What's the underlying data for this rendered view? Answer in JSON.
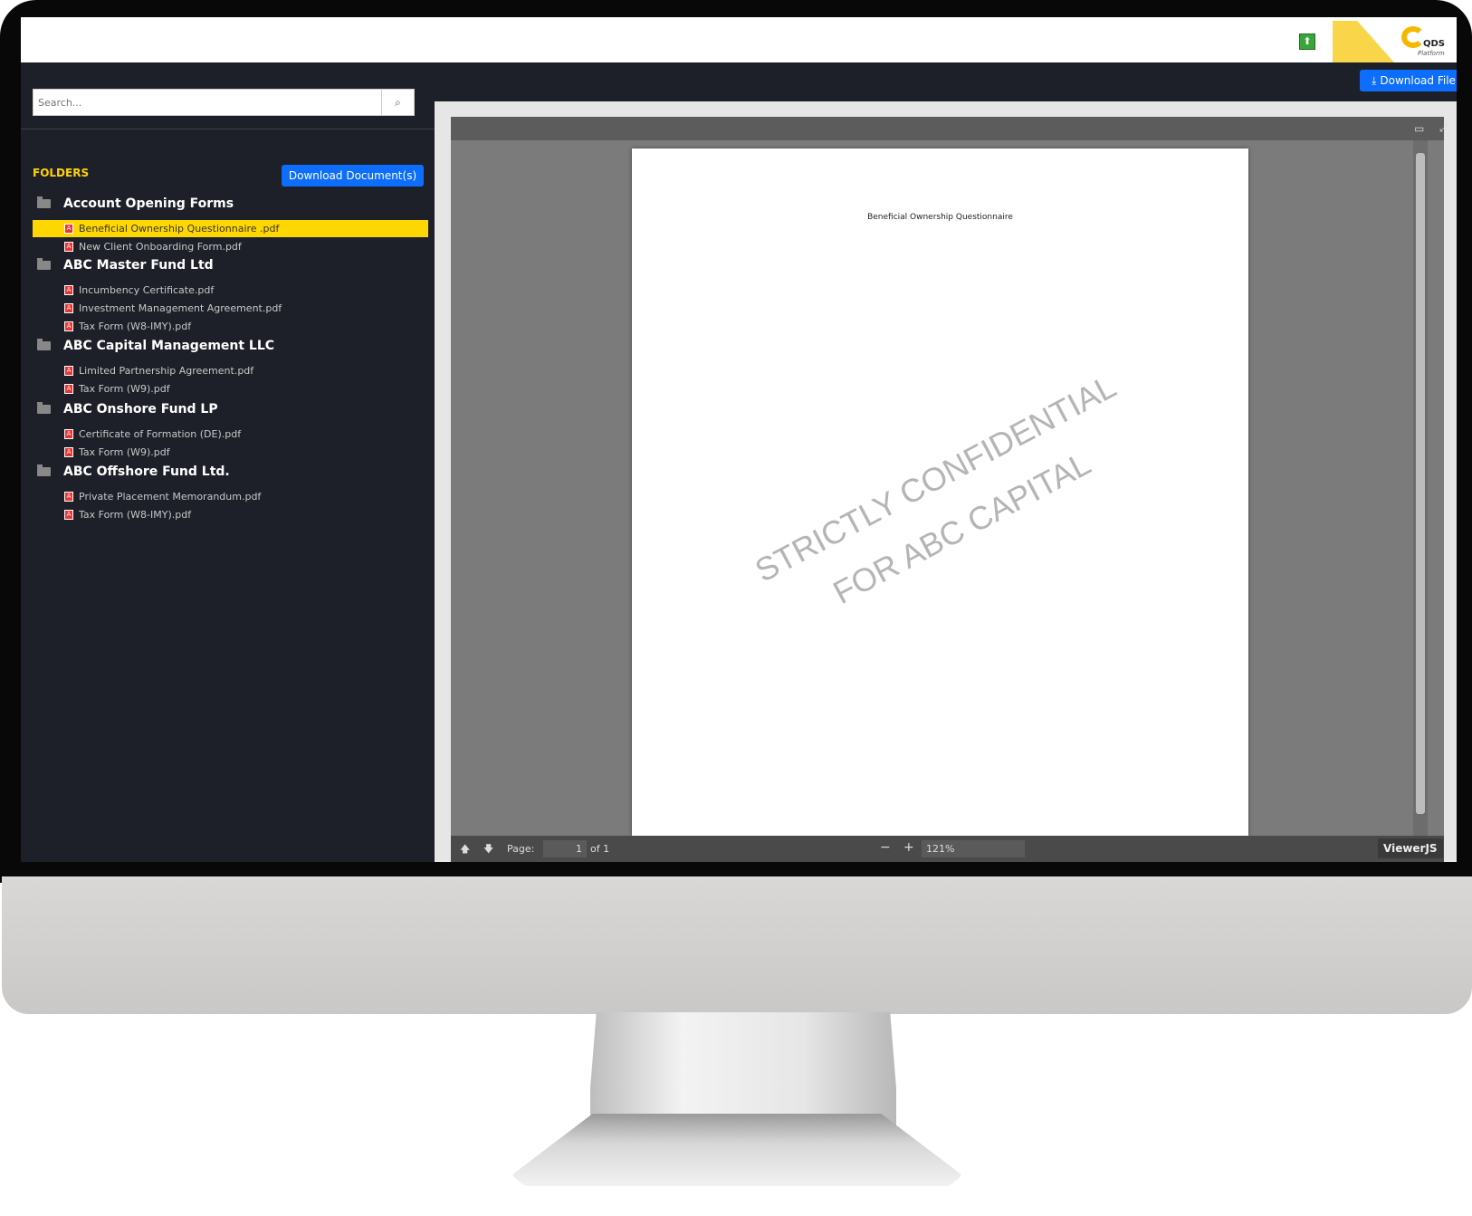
{
  "header": {
    "upload_icon": "upload-icon",
    "logo_text": "QDS",
    "logo_sub": "Platform"
  },
  "sidebar": {
    "search_placeholder": "Search...",
    "folders_label": "FOLDERS",
    "download_documents_label": "Download Document(s)",
    "folders": [
      {
        "name": "Account Opening Forms",
        "files": [
          "Beneficial Ownership Questionnaire .pdf",
          "New Client Onboarding Form.pdf"
        ]
      },
      {
        "name": "ABC Master Fund Ltd",
        "files": [
          "Incumbency Certificate.pdf",
          "Investment Management Agreement.pdf",
          "Tax Form (W8-IMY).pdf"
        ]
      },
      {
        "name": "ABC Capital Management LLC",
        "files": [
          "Limited Partnership Agreement.pdf",
          "Tax Form (W9).pdf"
        ]
      },
      {
        "name": "ABC Onshore Fund LP",
        "files": [
          "Certificate of Formation (DE).pdf",
          "Tax Form (W9).pdf"
        ]
      },
      {
        "name": "ABC Offshore Fund Ltd.",
        "files": [
          "Private Placement Memorandum.pdf",
          "Tax Form (W8-IMY).pdf"
        ]
      }
    ],
    "selected_file": "Beneficial Ownership Questionnaire .pdf"
  },
  "toolbar": {
    "download_file_label": "Download File"
  },
  "viewer": {
    "doc_title": "Beneficial Ownership Questionnaire",
    "watermark_line1": "STRICTLY CONFIDENTIAL",
    "watermark_line2": "FOR ABC CAPITAL",
    "page_label": "Page:",
    "page_value": "1",
    "page_of": "of 1",
    "zoom_value": "121%",
    "brand": "ViewerJS"
  },
  "colors": {
    "accent": "#0d6efd",
    "highlight": "#ffd700",
    "sidebar": "#1e2029"
  }
}
